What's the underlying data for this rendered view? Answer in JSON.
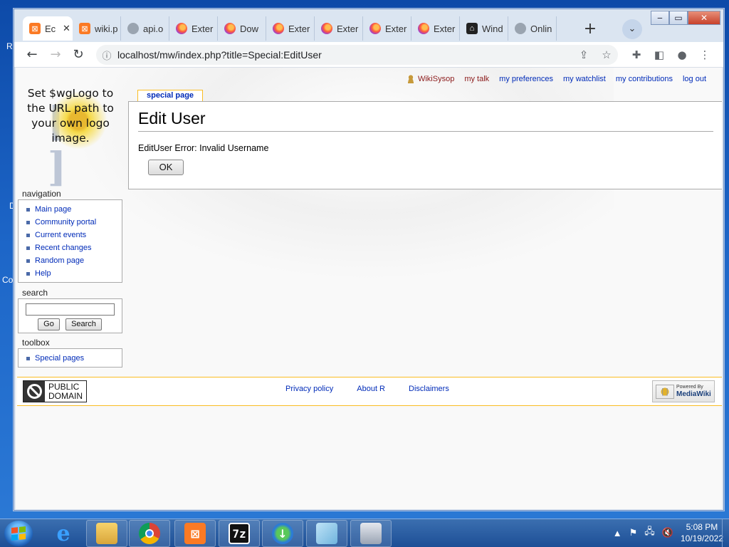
{
  "desktop": {
    "left_chars": [
      "R",
      "D",
      "Co"
    ],
    "ghost_footer": [
      "DOMAIN",
      "Privacy policy",
      "About R",
      "Disclaimers",
      "MediaWiki"
    ]
  },
  "browser": {
    "tabs": [
      {
        "label": "Ec",
        "icon": "xampp-icon",
        "active": true
      },
      {
        "label": "wiki.p",
        "icon": "xampp-icon"
      },
      {
        "label": "api.o",
        "icon": "globe-icon"
      },
      {
        "label": "Exter",
        "icon": "firefox-icon"
      },
      {
        "label": "Dow",
        "icon": "firefox-icon"
      },
      {
        "label": "Exter",
        "icon": "firefox-icon"
      },
      {
        "label": "Exter",
        "icon": "firefox-icon"
      },
      {
        "label": "Exter",
        "icon": "firefox-icon"
      },
      {
        "label": "Exter",
        "icon": "firefox-icon"
      },
      {
        "label": "Wind",
        "icon": "bank-icon"
      },
      {
        "label": "Onlin",
        "icon": "globe-icon"
      }
    ],
    "url": "localhost/mw/index.php?title=Special:EditUser"
  },
  "wiki": {
    "personal": {
      "user": "WikiSysop",
      "talk": "my talk",
      "preferences": "my preferences",
      "watchlist": "my watchlist",
      "contributions": "my contributions",
      "logout": "log out"
    },
    "logo_text": "Set $wgLogo to the URL path to your own logo image.",
    "navigation": {
      "heading": "navigation",
      "items": [
        "Main page",
        "Community portal",
        "Current events",
        "Recent changes",
        "Random page",
        "Help"
      ]
    },
    "search": {
      "heading": "search",
      "go": "Go",
      "search": "Search",
      "value": ""
    },
    "toolbox": {
      "heading": "toolbox",
      "items": [
        "Special pages"
      ]
    },
    "page_tab": "special page",
    "title": "Edit User",
    "error": "EditUser Error: Invalid Username",
    "ok": "OK",
    "footer": {
      "pd_line1": "PUBLIC",
      "pd_line2": "DOMAIN",
      "links": [
        "Privacy policy",
        "About R",
        "Disclaimers"
      ],
      "powered_small": "Powered By",
      "powered_big": "MediaWiki"
    }
  },
  "taskbar": {
    "time": "5:08 PM",
    "date": "10/19/2022"
  }
}
